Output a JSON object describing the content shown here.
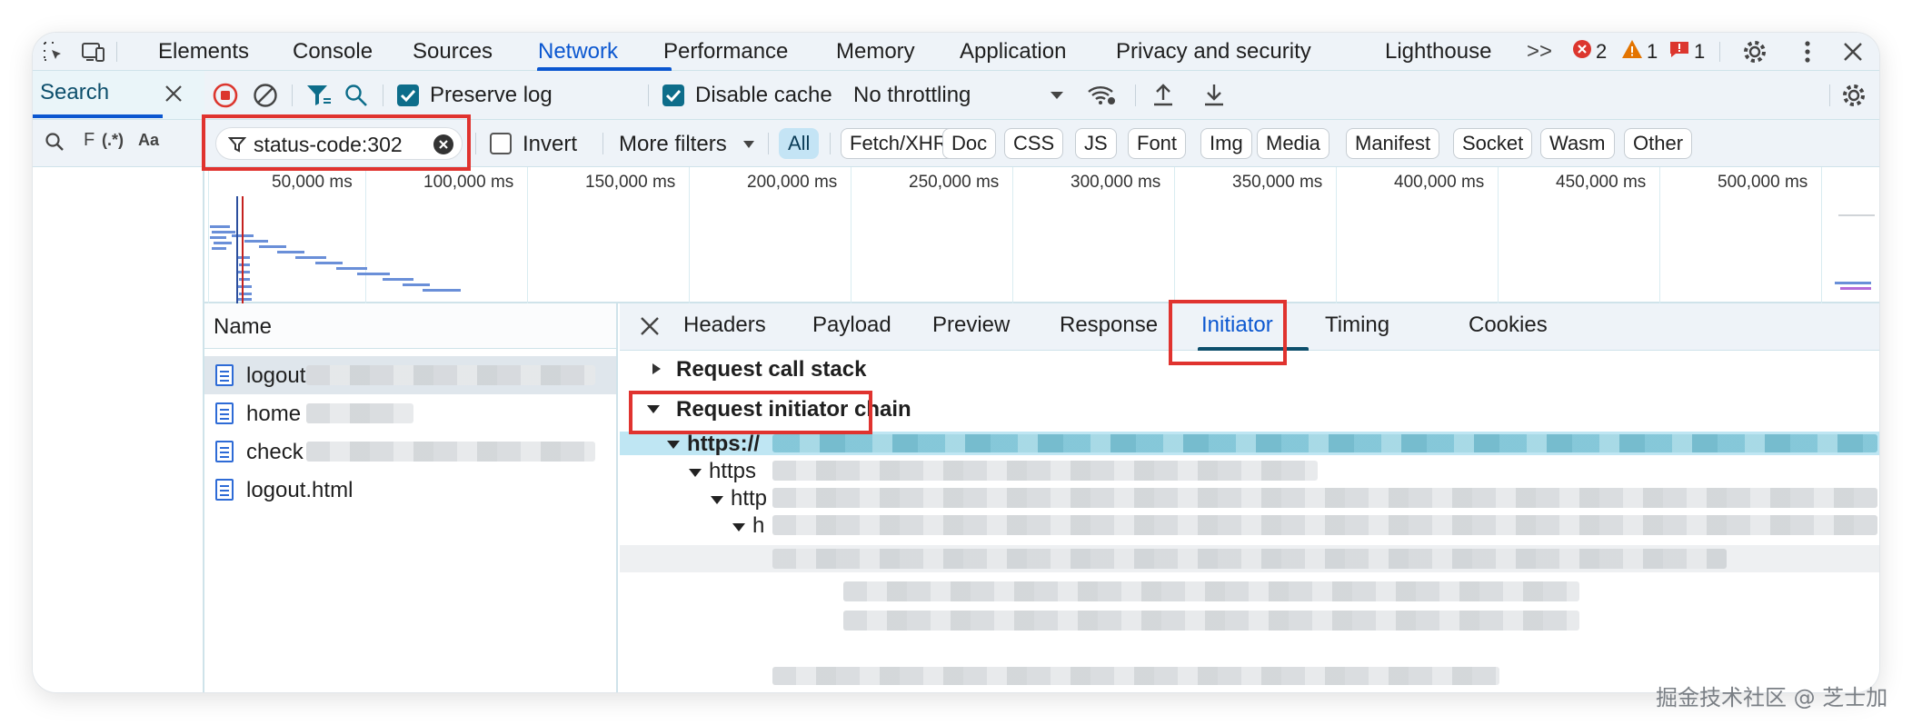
{
  "tabs": {
    "elements": "Elements",
    "console": "Console",
    "sources": "Sources",
    "network": "Network",
    "performance": "Performance",
    "memory": "Memory",
    "application": "Application",
    "privacy": "Privacy and security",
    "lighthouse": "Lighthouse",
    "more": ">>"
  },
  "counters": {
    "errors": "2",
    "warnings": "1",
    "issues": "1"
  },
  "search_panel": {
    "title": "Search",
    "option_case": "Aa",
    "option_regex": "(.*)"
  },
  "toolbar": {
    "preserve_log": "Preserve log",
    "preserve_log_checked": true,
    "disable_cache": "Disable cache",
    "disable_cache_checked": true,
    "throttling": "No throttling"
  },
  "filter": {
    "value": "status-code:302",
    "invert": "Invert",
    "invert_checked": false,
    "more_filters": "More filters",
    "types": [
      "All",
      "Fetch/XHR",
      "Doc",
      "CSS",
      "JS",
      "Font",
      "Img",
      "Media",
      "Manifest",
      "Socket",
      "Wasm",
      "Other"
    ],
    "active_type": "All"
  },
  "overview": {
    "ticks": [
      "50,000 ms",
      "100,000 ms",
      "150,000 ms",
      "200,000 ms",
      "250,000 ms",
      "300,000 ms",
      "350,000 ms",
      "400,000 ms",
      "450,000 ms",
      "500,000 ms"
    ]
  },
  "requests": {
    "header": "Name",
    "rows": [
      {
        "name": "logout",
        "selected": true
      },
      {
        "name": "home"
      },
      {
        "name": "check"
      },
      {
        "name": "logout.html"
      }
    ]
  },
  "detail": {
    "tabs": [
      "Headers",
      "Payload",
      "Preview",
      "Response",
      "Initiator",
      "Timing",
      "Cookies"
    ],
    "active_tab": "Initiator",
    "call_stack": "Request call stack",
    "initiator_chain": "Request initiator chain",
    "chain": [
      "https://",
      "https",
      "http",
      "h"
    ]
  },
  "watermark": "掘金技术社区 @ 芝士加",
  "colors": {
    "accent": "#0b57d0",
    "highlight_box": "#e0332f",
    "panel_bg": "#eef3f8",
    "chip_active": "#c4e4f5"
  }
}
